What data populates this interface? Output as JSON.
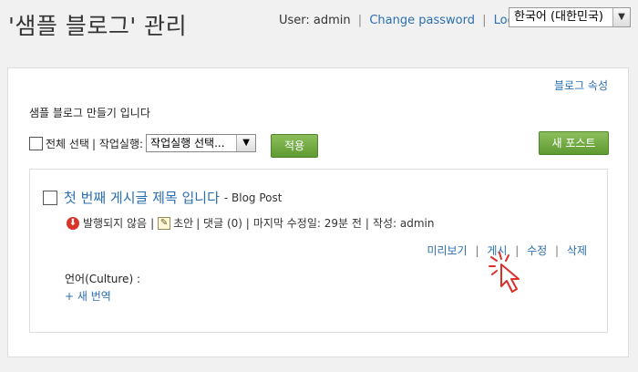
{
  "header": {
    "title": "'샘플 블로그' 관리",
    "user_label": "User: admin",
    "change_password": "Change password",
    "logout": "Logout",
    "separator": "|",
    "language": "한국어 (대한민국)"
  },
  "panel": {
    "blog_settings": "블로그 속성",
    "subtitle": "샘플 블로그 만들기 입니다",
    "select_all": "전체 선택",
    "bulk_action_label": "| 작업실행:",
    "bulk_action_value": "작업실행 선택...",
    "apply": "적용",
    "new_post": "새 포스트"
  },
  "post": {
    "title": "첫 번째 게시글 제목 입니다",
    "type": "- Blog Post",
    "status": "발행되지 않음",
    "meta_sep1": "|",
    "draft": "초안",
    "comments": "| 댓글 (0) |",
    "last_modified": "마지막 수정일: 29분 전",
    "meta_sep2": "|",
    "author": "작성: admin",
    "actions": {
      "preview": "미리보기",
      "publish": "게시",
      "edit": "수정",
      "delete": "삭제",
      "sep": "|"
    },
    "culture": "언어(Culture) :",
    "new_translation": "+ 새 번역"
  },
  "icons": {
    "unpublished": "unpublished-icon",
    "draft": "draft-icon",
    "cursor": "cursor-arrow-icon"
  },
  "colors": {
    "accent": "#2a6fb0",
    "button": "#6ea63e",
    "unpublished": "#d9332a",
    "cursor": "#d9302a"
  }
}
